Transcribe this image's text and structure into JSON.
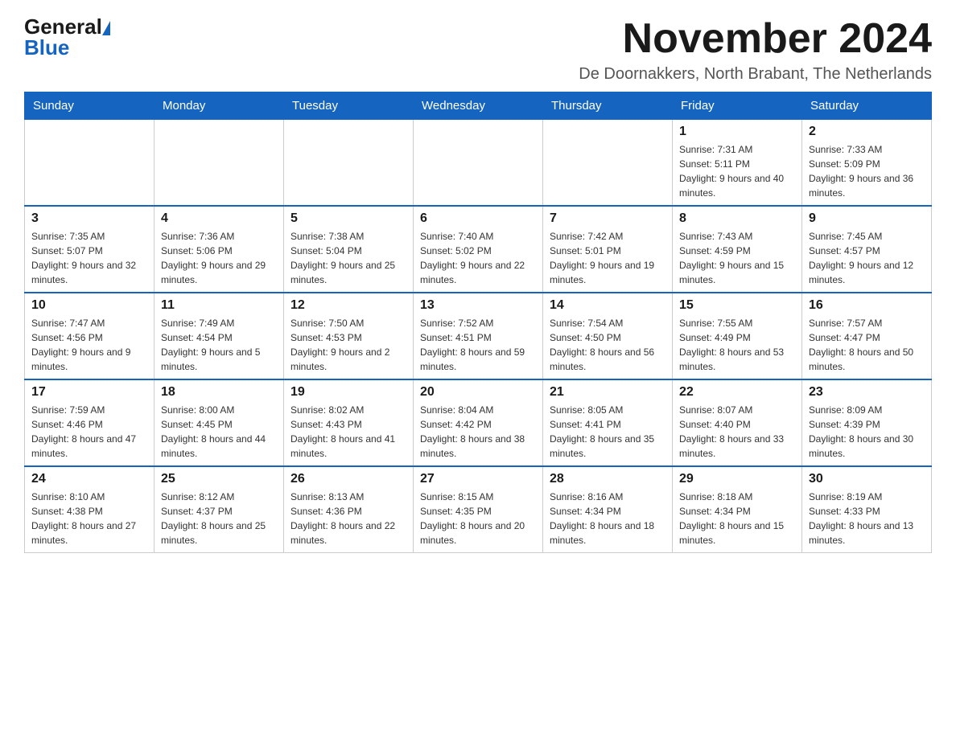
{
  "logo": {
    "general": "General",
    "blue": "Blue"
  },
  "title": "November 2024",
  "location": "De Doornakkers, North Brabant, The Netherlands",
  "days_of_week": [
    "Sunday",
    "Monday",
    "Tuesday",
    "Wednesday",
    "Thursday",
    "Friday",
    "Saturday"
  ],
  "weeks": [
    [
      {
        "day": "",
        "info": ""
      },
      {
        "day": "",
        "info": ""
      },
      {
        "day": "",
        "info": ""
      },
      {
        "day": "",
        "info": ""
      },
      {
        "day": "",
        "info": ""
      },
      {
        "day": "1",
        "info": "Sunrise: 7:31 AM\nSunset: 5:11 PM\nDaylight: 9 hours and 40 minutes."
      },
      {
        "day": "2",
        "info": "Sunrise: 7:33 AM\nSunset: 5:09 PM\nDaylight: 9 hours and 36 minutes."
      }
    ],
    [
      {
        "day": "3",
        "info": "Sunrise: 7:35 AM\nSunset: 5:07 PM\nDaylight: 9 hours and 32 minutes."
      },
      {
        "day": "4",
        "info": "Sunrise: 7:36 AM\nSunset: 5:06 PM\nDaylight: 9 hours and 29 minutes."
      },
      {
        "day": "5",
        "info": "Sunrise: 7:38 AM\nSunset: 5:04 PM\nDaylight: 9 hours and 25 minutes."
      },
      {
        "day": "6",
        "info": "Sunrise: 7:40 AM\nSunset: 5:02 PM\nDaylight: 9 hours and 22 minutes."
      },
      {
        "day": "7",
        "info": "Sunrise: 7:42 AM\nSunset: 5:01 PM\nDaylight: 9 hours and 19 minutes."
      },
      {
        "day": "8",
        "info": "Sunrise: 7:43 AM\nSunset: 4:59 PM\nDaylight: 9 hours and 15 minutes."
      },
      {
        "day": "9",
        "info": "Sunrise: 7:45 AM\nSunset: 4:57 PM\nDaylight: 9 hours and 12 minutes."
      }
    ],
    [
      {
        "day": "10",
        "info": "Sunrise: 7:47 AM\nSunset: 4:56 PM\nDaylight: 9 hours and 9 minutes."
      },
      {
        "day": "11",
        "info": "Sunrise: 7:49 AM\nSunset: 4:54 PM\nDaylight: 9 hours and 5 minutes."
      },
      {
        "day": "12",
        "info": "Sunrise: 7:50 AM\nSunset: 4:53 PM\nDaylight: 9 hours and 2 minutes."
      },
      {
        "day": "13",
        "info": "Sunrise: 7:52 AM\nSunset: 4:51 PM\nDaylight: 8 hours and 59 minutes."
      },
      {
        "day": "14",
        "info": "Sunrise: 7:54 AM\nSunset: 4:50 PM\nDaylight: 8 hours and 56 minutes."
      },
      {
        "day": "15",
        "info": "Sunrise: 7:55 AM\nSunset: 4:49 PM\nDaylight: 8 hours and 53 minutes."
      },
      {
        "day": "16",
        "info": "Sunrise: 7:57 AM\nSunset: 4:47 PM\nDaylight: 8 hours and 50 minutes."
      }
    ],
    [
      {
        "day": "17",
        "info": "Sunrise: 7:59 AM\nSunset: 4:46 PM\nDaylight: 8 hours and 47 minutes."
      },
      {
        "day": "18",
        "info": "Sunrise: 8:00 AM\nSunset: 4:45 PM\nDaylight: 8 hours and 44 minutes."
      },
      {
        "day": "19",
        "info": "Sunrise: 8:02 AM\nSunset: 4:43 PM\nDaylight: 8 hours and 41 minutes."
      },
      {
        "day": "20",
        "info": "Sunrise: 8:04 AM\nSunset: 4:42 PM\nDaylight: 8 hours and 38 minutes."
      },
      {
        "day": "21",
        "info": "Sunrise: 8:05 AM\nSunset: 4:41 PM\nDaylight: 8 hours and 35 minutes."
      },
      {
        "day": "22",
        "info": "Sunrise: 8:07 AM\nSunset: 4:40 PM\nDaylight: 8 hours and 33 minutes."
      },
      {
        "day": "23",
        "info": "Sunrise: 8:09 AM\nSunset: 4:39 PM\nDaylight: 8 hours and 30 minutes."
      }
    ],
    [
      {
        "day": "24",
        "info": "Sunrise: 8:10 AM\nSunset: 4:38 PM\nDaylight: 8 hours and 27 minutes."
      },
      {
        "day": "25",
        "info": "Sunrise: 8:12 AM\nSunset: 4:37 PM\nDaylight: 8 hours and 25 minutes."
      },
      {
        "day": "26",
        "info": "Sunrise: 8:13 AM\nSunset: 4:36 PM\nDaylight: 8 hours and 22 minutes."
      },
      {
        "day": "27",
        "info": "Sunrise: 8:15 AM\nSunset: 4:35 PM\nDaylight: 8 hours and 20 minutes."
      },
      {
        "day": "28",
        "info": "Sunrise: 8:16 AM\nSunset: 4:34 PM\nDaylight: 8 hours and 18 minutes."
      },
      {
        "day": "29",
        "info": "Sunrise: 8:18 AM\nSunset: 4:34 PM\nDaylight: 8 hours and 15 minutes."
      },
      {
        "day": "30",
        "info": "Sunrise: 8:19 AM\nSunset: 4:33 PM\nDaylight: 8 hours and 13 minutes."
      }
    ]
  ]
}
